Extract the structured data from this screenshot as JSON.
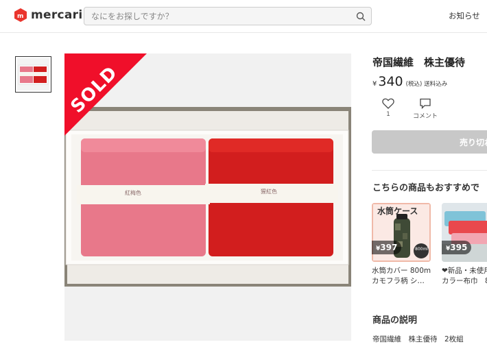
{
  "header": {
    "brand": "mercari",
    "search_placeholder": "なにをお探しですか？",
    "notifications_label": "お知らせ"
  },
  "photo": {
    "sold_label": "SOLD",
    "left_band_text": "紅梅色",
    "right_band_text": "猩紅色"
  },
  "item": {
    "title": "帝国繊維　株主優待",
    "currency": "¥",
    "price": "340",
    "tax_note": "(税込)",
    "shipping_note": "送料込み",
    "like_count": "1",
    "comment_label": "コメント",
    "sold_out_label": "売り切れ"
  },
  "recommendations": {
    "heading": "こちらの商品もおすすめで",
    "items": [
      {
        "price": "397",
        "tag_text": "水筒ケース",
        "sub_label": "800ml",
        "name_line1": "水筒カバー 800ml",
        "name_line2": "カモフラ柄 シ…"
      },
      {
        "price": "395",
        "name_line1": "❤新品・未使用",
        "name_line2": "カラー布巾　8"
      }
    ]
  },
  "description": {
    "heading": "商品の説明",
    "text": "帝国繊維　株主優待　2枚組"
  },
  "colors": {
    "sold_red": "#f00f2a",
    "pink_towel": "#e8788a",
    "red_towel": "#d21e1e",
    "soldout_gray": "#c8c8c8"
  }
}
